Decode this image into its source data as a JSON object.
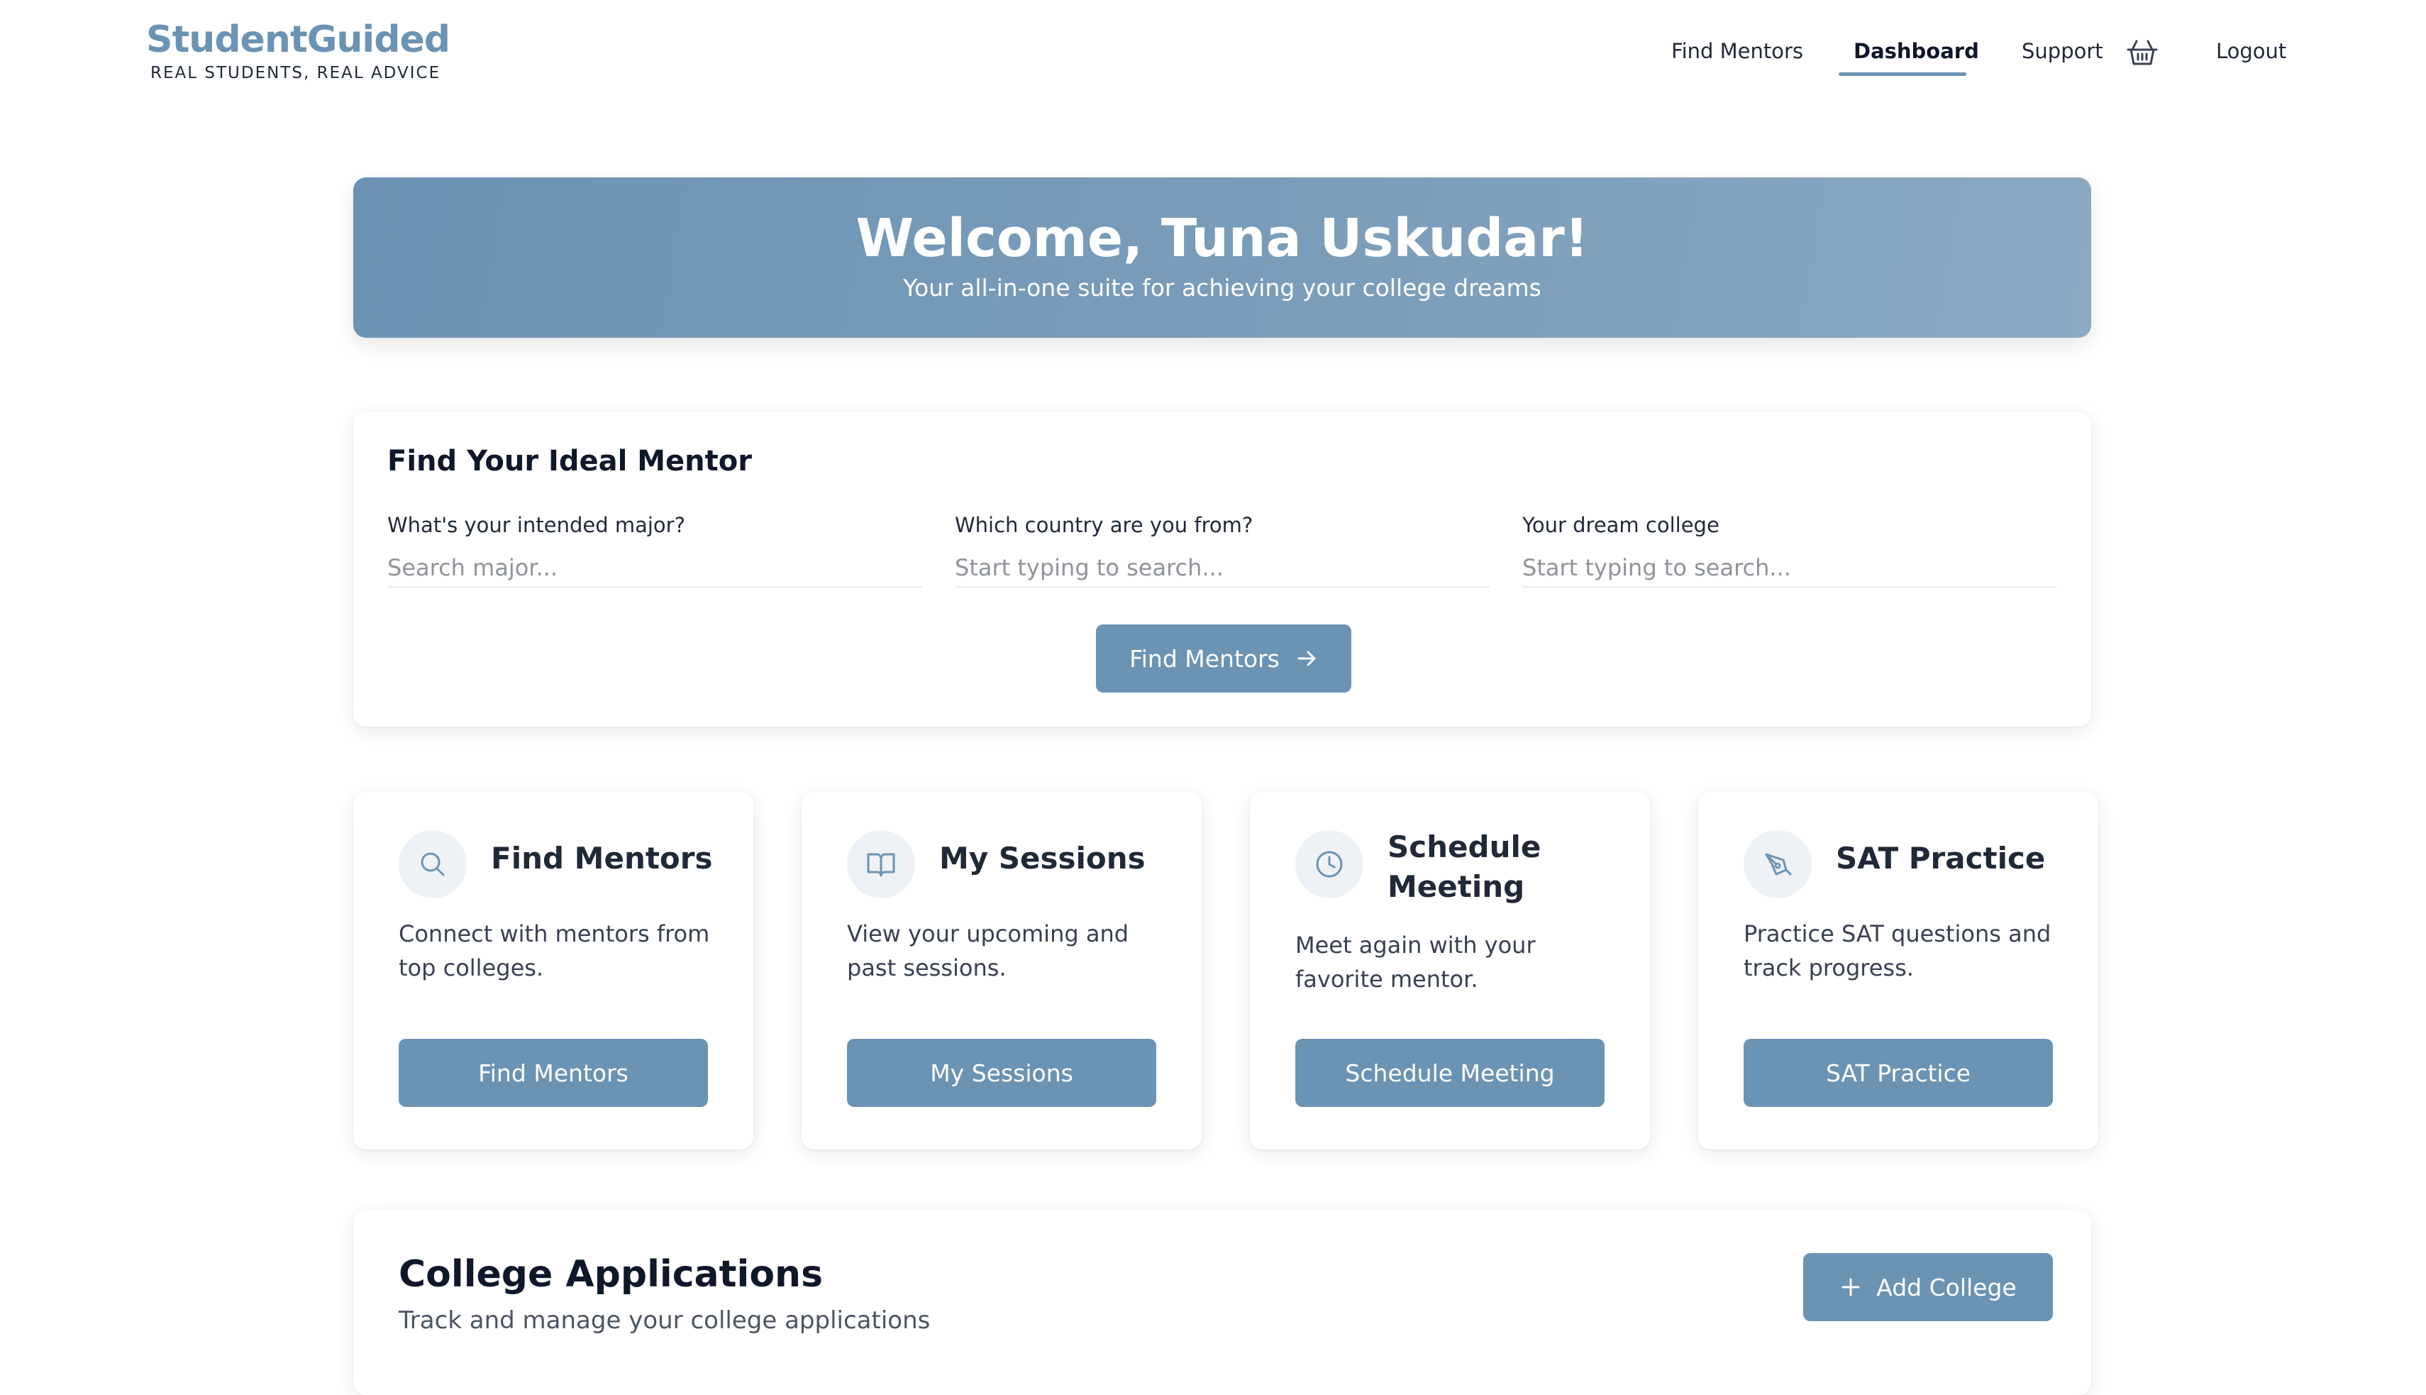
{
  "brand": {
    "name": "StudentGuided",
    "tagline": "REAL STUDENTS, REAL ADVICE",
    "accent_color": "#6b93b3"
  },
  "nav": {
    "items": [
      {
        "label": "Find Mentors",
        "active": false
      },
      {
        "label": "Dashboard",
        "active": true
      },
      {
        "label": "Support",
        "active": false
      }
    ],
    "cart_icon": "basket-icon",
    "logout_label": "Logout"
  },
  "welcome": {
    "title": "Welcome, Tuna Uskudar!",
    "subtitle": "Your all-in-one suite for achieving your college dreams"
  },
  "mentor_search": {
    "title": "Find Your Ideal Mentor",
    "fields": [
      {
        "label": "What's your intended major?",
        "placeholder": "Search major...",
        "value": ""
      },
      {
        "label": "Which country are you from?",
        "placeholder": "Start typing to search...",
        "value": ""
      },
      {
        "label": "Your dream college",
        "placeholder": "Start typing to search...",
        "value": ""
      }
    ],
    "button_label": "Find Mentors",
    "button_icon": "arrow-right-icon"
  },
  "features": [
    {
      "title": "Find Mentors",
      "description": "Connect with mentors from top colleges.",
      "button_label": "Find Mentors",
      "icon": "search-icon"
    },
    {
      "title": "My Sessions",
      "description": "View your upcoming and past sessions.",
      "button_label": "My Sessions",
      "icon": "book-icon"
    },
    {
      "title": "Schedule Meeting",
      "description": "Meet again with your favorite mentor.",
      "button_label": "Schedule Meeting",
      "icon": "clock-icon"
    },
    {
      "title": "SAT Practice",
      "description": "Practice SAT questions and track progress.",
      "button_label": "SAT Practice",
      "icon": "pen-tool-icon"
    }
  ],
  "college_applications": {
    "title": "College Applications",
    "subtitle": "Track and manage your college applications",
    "add_button_label": "Add College",
    "add_button_icon": "plus-icon"
  }
}
